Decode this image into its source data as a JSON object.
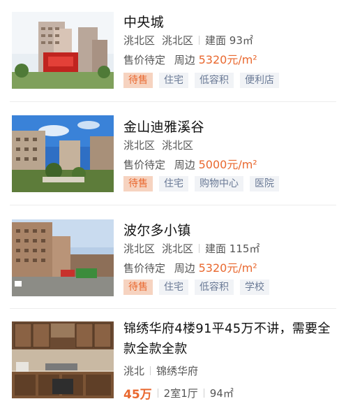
{
  "listings": [
    {
      "title": "中央城",
      "district": "洮北区",
      "area_name": "洮北区",
      "build_area": "建面 93㎡",
      "price_status": "售价待定",
      "nearby_label": "周边",
      "nearby_price": "5320元/m²",
      "tags": [
        "待售",
        "住宅",
        "低容积",
        "便利店"
      ]
    },
    {
      "title": "金山迪雅溪谷",
      "district": "洮北区",
      "area_name": "洮北区",
      "price_status": "售价待定",
      "nearby_label": "周边",
      "nearby_price": "5000元/m²",
      "tags": [
        "待售",
        "住宅",
        "购物中心",
        "医院"
      ]
    },
    {
      "title": "波尔多小镇",
      "district": "洮北区",
      "area_name": "洮北区",
      "build_area": "建面 115㎡",
      "price_status": "售价待定",
      "nearby_label": "周边",
      "nearby_price": "5320元/m²",
      "tags": [
        "待售",
        "住宅",
        "低容积",
        "学校"
      ]
    },
    {
      "title": "锦绣华府4楼91平45万不讲，需要全款全款全款",
      "district": "洮北",
      "community": "锦绣华府",
      "price": "45万",
      "layout": "2室1厅",
      "area": "94㎡"
    }
  ],
  "colors": {
    "accent": "#e9682f",
    "tag_bg": "#f1f3f6",
    "sale_tag_bg": "#f6d3c0"
  }
}
